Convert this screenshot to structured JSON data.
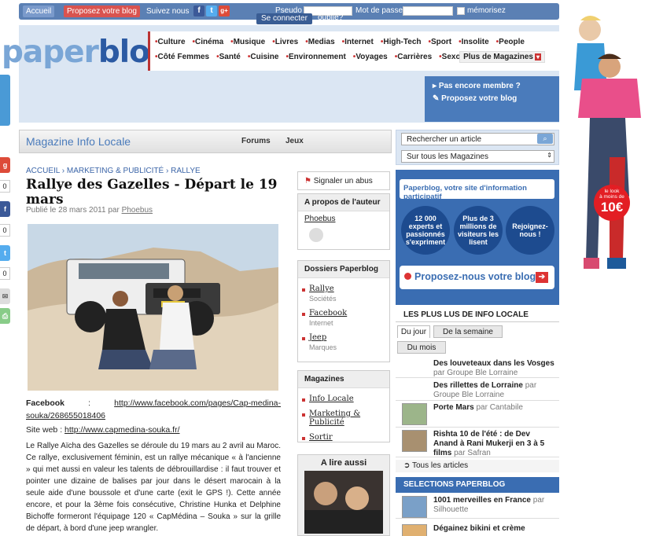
{
  "topbar": {
    "home": "Accueil",
    "propose": "Proposez votre blog",
    "follow": "Suivez nous",
    "pseudo": "Pseudo",
    "password": "Mot de passe",
    "remember": "mémorisez",
    "connect": "Se connecter",
    "forgot": "oublié?"
  },
  "logo": {
    "part1": "paper",
    "part2": "blog"
  },
  "nav": {
    "row1": [
      "Culture",
      "Cinéma",
      "Musique",
      "Livres",
      "Medias",
      "Internet",
      "High-Tech",
      "Sport",
      "Insolite",
      "People"
    ],
    "row2": [
      "Côté Femmes",
      "Santé",
      "Cuisine",
      "Environnement",
      "Voyages",
      "Carrières",
      "Sexo"
    ],
    "more": "Plus de Magazines"
  },
  "member": {
    "line1": "Pas encore membre ?",
    "line2": "Proposez votre blog"
  },
  "side": {
    "counts": [
      "0",
      "0",
      "0"
    ]
  },
  "magbar": {
    "title": "Magazine Info Locale",
    "tab1": "Forums",
    "tab2": "Jeux"
  },
  "article": {
    "crumb": "ACCUEIL › MARKETING & PUBLICITÉ › RALLYE",
    "title": "Rallye des Gazelles - Départ le 19 mars",
    "pub_prefix": "Publié le 28 mars 2011 par ",
    "author": "Phoebus",
    "fb_label": "Facebook",
    "fb_url": "http://www.facebook.com/pages/Cap-medina-souka/268655018406",
    "site_label": "Site web : ",
    "site_url": "http://www.capmedina-souka.fr/",
    "p1": "Le Rallye Aïcha des Gazelles se déroule du 19 mars au 2 avril au Maroc. Ce rallye, exclusivement féminin, est un rallye mécanique « à l'ancienne » qui met aussi en valeur les talents de débrouillardise : il faut trouver et pointer une dizaine de balises par jour dans le désert marocain à la seule aide d'une boussole et d'une carte (exit le GPS !). Cette année encore, et pour la 3ème fois consécutive, Christine Hunka et Delphine Bichoffe formeront l'équipage 120 « CapMédina – Souka » sur la grille de départ, à bord d'une jeep wrangler."
  },
  "middle": {
    "report": "Signaler un abus",
    "about_h": "A propos de l'auteur",
    "about_name": "Phoebus",
    "dossiers_h": "Dossiers Paperblog",
    "dossiers": [
      {
        "name": "Rallye",
        "sub": "Sociétés"
      },
      {
        "name": "Facebook",
        "sub": "Internet"
      },
      {
        "name": "Jeep",
        "sub": "Marques"
      }
    ],
    "mags_h": "Magazines",
    "mags": [
      "Info Locale",
      "Marketing & Publicité",
      "Sortir"
    ],
    "alire": "A lire aussi"
  },
  "right": {
    "search_placeholder": "Rechercher un article",
    "select_value": "Sur tous les Magazines",
    "promo_top": "Paperblog, votre site d'information participatif",
    "circles": [
      "12 000 experts et passionnés s'expriment",
      "Plus de 3 millions de visiteurs les lisent",
      "Rejoignez-nous !"
    ],
    "promo_btn": "Proposez-nous votre blog",
    "mostread_h": "LES PLUS LUS DE INFO LOCALE",
    "tabs": [
      "Du jour",
      "De la semaine",
      "Du mois"
    ],
    "items": [
      {
        "title": "Des louveteaux dans les Vosges",
        "by": "par",
        "src": "Groupe Ble Lorraine"
      },
      {
        "title": "Des rillettes de Lorraine",
        "by": "par",
        "src": "Groupe Ble Lorraine"
      },
      {
        "title": "Porte Mars",
        "by": "par",
        "src": "Cantabile"
      },
      {
        "title": "Rishta 10 de l'été : de Dev Anand à Rani Mukerji en 3 à 5 films",
        "by": "par",
        "src": "Safran"
      }
    ],
    "toutes": "Tous les articles",
    "sel_h": "SELECTIONS PAPERBLOG",
    "sel_items": [
      {
        "title": "1001 merveilles en France",
        "by": "par",
        "src": "Silhouette"
      },
      {
        "title": "Dégainez bikini et crème"
      }
    ]
  },
  "ad": {
    "line1": "le look",
    "line2": "à moins de",
    "price": "10€"
  }
}
